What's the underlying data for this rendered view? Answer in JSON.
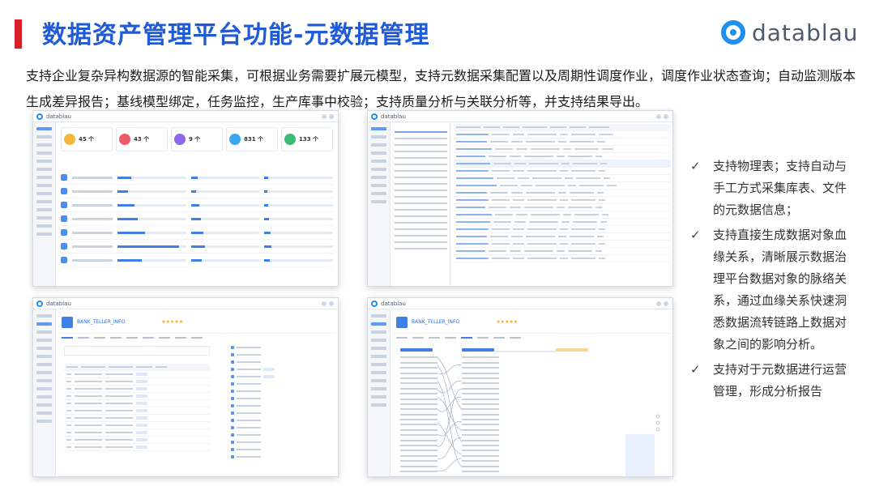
{
  "header": {
    "title": "数据资产管理平台功能-元数据管理",
    "brand": "datablau"
  },
  "description": "支持企业复杂异构数据源的智能采集，可根据业务需要扩展元模型，支持元数据采集配置以及周期性调度作业，调度作业状态查询；自动监测版本生成差异报告；基线模型绑定，任务监控，生产库事中校验；支持质量分析与关联分析等，并支持结果导出。",
  "screenshots": {
    "brand": "datablau",
    "dashboard": {
      "cards": [
        {
          "value": "45 个",
          "color": "#f6b73c"
        },
        {
          "value": "43 个",
          "color": "#ef5a67"
        },
        {
          "value": "9 个",
          "color": "#8b6bea"
        },
        {
          "value": "831 个",
          "color": "#3ba6f2"
        },
        {
          "value": "133 个",
          "color": "#3dbb77"
        }
      ]
    },
    "detail": {
      "table_name": "BANK_TELLER_INFO",
      "stars": "★★★★★"
    }
  },
  "checklist": [
    {
      "mark": "✓",
      "text": "支持物理表；支持自动与手工方式采集库表、文件的元数据信息；"
    },
    {
      "mark": "✓",
      "text": "支持直接生成数据对象血缘关系，清晰展示数据治理平台数据对象的脉络关系，通过血缘关系快速洞悉数据流转链路上数据对象之间的影响分析。"
    },
    {
      "mark": "✓",
      "text": "支持对于元数据进行运营管理，形成分析报告"
    }
  ],
  "colors": {
    "title": "#1f5bd6",
    "accent_bar": "#d61f26",
    "brand": "#1f8ff0"
  }
}
